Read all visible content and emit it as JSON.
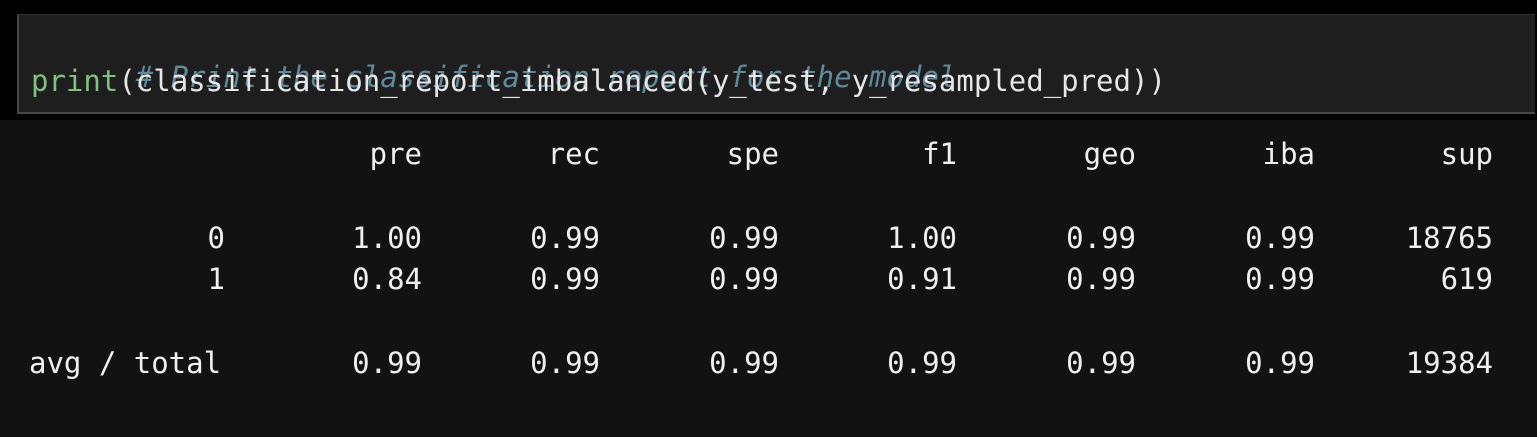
{
  "code": {
    "comment": "# Print the classification report for the model",
    "call_builtin": "print",
    "call_open": "(",
    "call_fn": "classification_report_imbalanced",
    "call_args": "(y_test, y_resampled_pred)",
    "call_close": ")"
  },
  "report": {
    "headers": [
      "pre",
      "rec",
      "spe",
      "f1",
      "geo",
      "iba",
      "sup"
    ],
    "rows": [
      {
        "label": "0",
        "values": [
          "1.00",
          "0.99",
          "0.99",
          "1.00",
          "0.99",
          "0.99",
          "18765"
        ]
      },
      {
        "label": "1",
        "values": [
          "0.84",
          "0.99",
          "0.99",
          "0.91",
          "0.99",
          "0.99",
          "619"
        ]
      },
      {
        "label": "avg / total",
        "values": [
          "0.99",
          "0.99",
          "0.99",
          "0.99",
          "0.99",
          "0.99",
          "19384"
        ]
      }
    ]
  },
  "colors": {
    "comment": "#5f8a9a",
    "builtin": "#7ec27e",
    "text": "#e6e6e6",
    "cell_background": "#1e1e1e",
    "output_background": "#121212"
  }
}
